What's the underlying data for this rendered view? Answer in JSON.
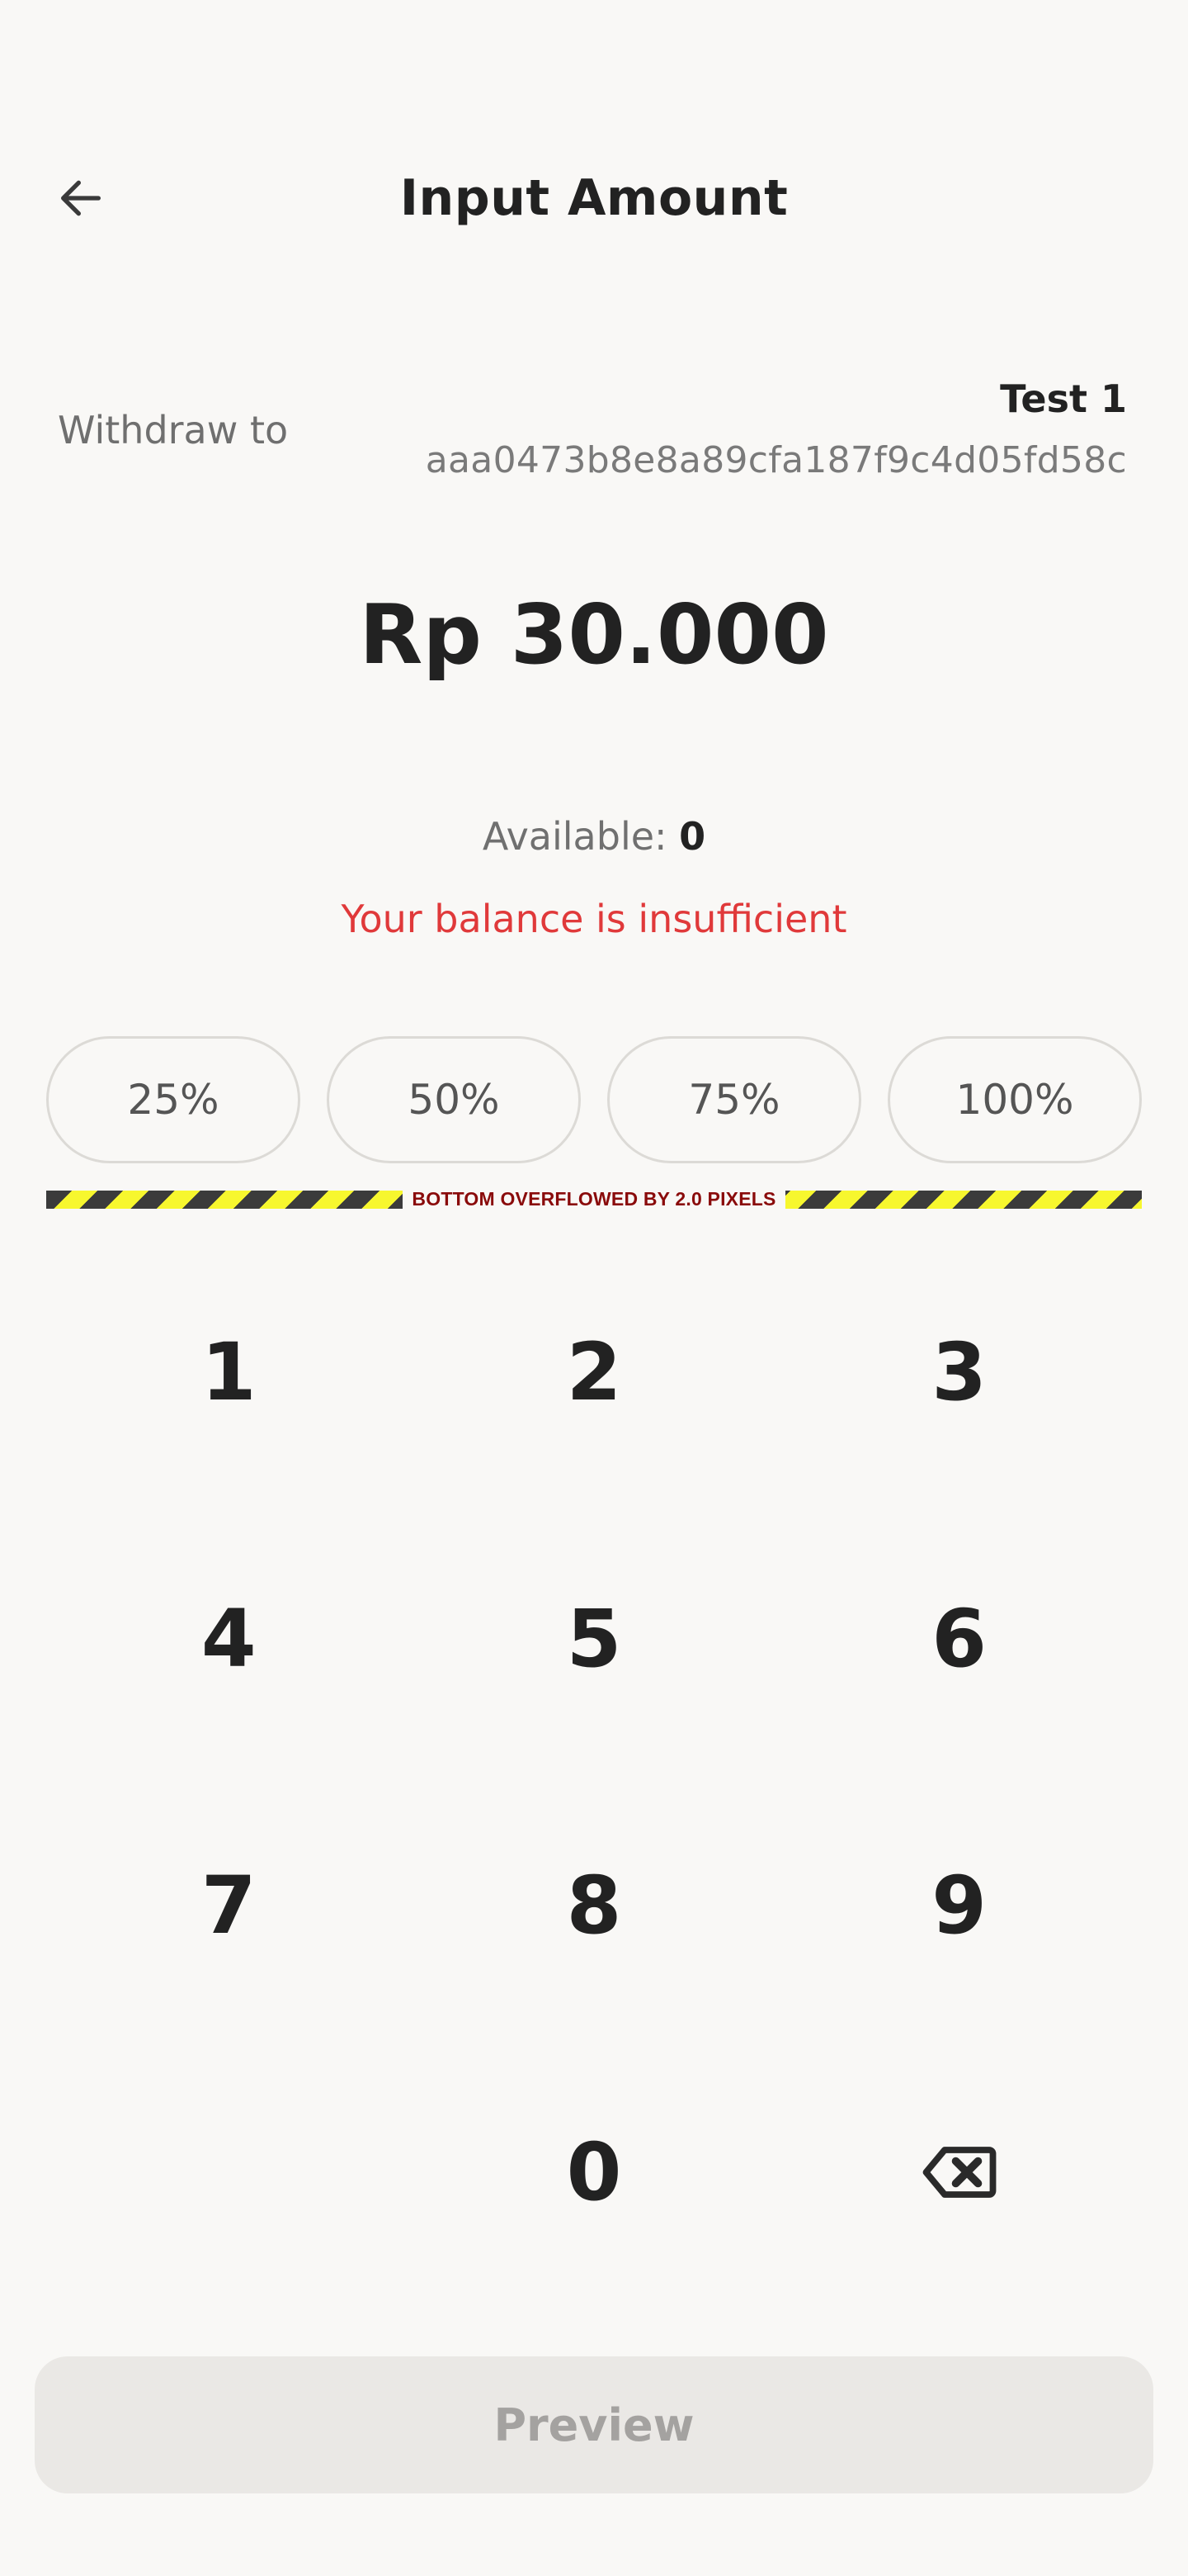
{
  "header": {
    "title": "Input Amount",
    "back_icon": "arrow-left-icon"
  },
  "withdraw": {
    "label": "Withdraw to",
    "recipient_name": "Test 1",
    "recipient_id": "aaa0473b8e8a89cfa187f9c4d05fd58c"
  },
  "amount": {
    "display": "Rp 30.000"
  },
  "balance": {
    "available_label": "Available:",
    "available_value": "0",
    "error": "Your balance is insufficient"
  },
  "percent_buttons": [
    "25%",
    "50%",
    "75%",
    "100%"
  ],
  "debug": {
    "overflow_message": "BOTTOM OVERFLOWED BY 2.0 PIXELS"
  },
  "keypad": {
    "keys": [
      "1",
      "2",
      "3",
      "4",
      "5",
      "6",
      "7",
      "8",
      "9",
      "",
      "0",
      "backspace"
    ],
    "backspace_icon": "backspace-icon"
  },
  "footer": {
    "preview_label": "Preview"
  },
  "colors": {
    "background": "#f9f8f6",
    "text": "#222222",
    "error": "#e0393a",
    "muted": "#707070",
    "button_disabled_bg": "#eae8e5",
    "button_disabled_text": "#a4a2a0"
  }
}
